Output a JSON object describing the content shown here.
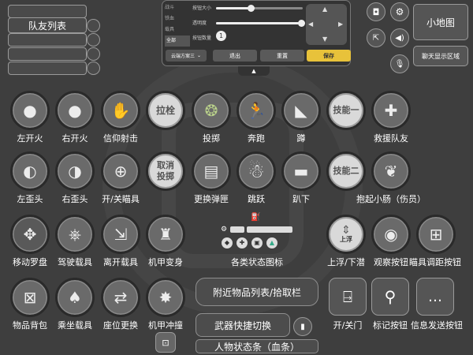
{
  "team": {
    "title": "队友列表"
  },
  "settings": {
    "tabs": [
      "战斗",
      "铁血",
      "载具",
      "全部"
    ],
    "sliders": [
      {
        "label": "按钮大小",
        "value": 0.4
      },
      {
        "label": "透明度",
        "value": 0.98
      }
    ],
    "count_label": "按钮数量",
    "count_value": "1",
    "scheme": "云端方案三",
    "exit_label": "退出",
    "reset_label": "重置",
    "save_label": "保存"
  },
  "right_top": {
    "minimap_label": "小地图",
    "chat_area_label": "聊天显示区域"
  },
  "buttons": {
    "fire_left": "左开火",
    "fire_right": "右开火",
    "faith_shoot": "信仰射击",
    "pull_pin_text": "拉栓",
    "pull_pin_label": "",
    "throw": "投掷",
    "run": "奔跑",
    "crouch": "蹲",
    "skill1_text": "技能一",
    "rescue": "救援队友",
    "lean_left": "左歪头",
    "lean_right": "右歪头",
    "scope": "开/关瞄具",
    "cancel_throw_text": "取消\n投掷",
    "reload": "更换弹匣",
    "jump": "跳跃",
    "prone": "趴下",
    "skill2_text": "技能二",
    "carry": "抱起小肠（伤员）",
    "compass": "移动罗盘",
    "drive": "驾驶载具",
    "leave_vehicle": "离开载具",
    "mech_transform": "机甲变身",
    "status_icons": "各类状态图标",
    "float_dive_small": "上浮",
    "float_dive": "上浮/下潜",
    "observe": "观察按钮",
    "scope_adjust": "瞄具调距按钮",
    "backpack": "物品背包",
    "ride": "乘坐载具",
    "seat_change": "座位更换",
    "mech_charge": "机甲冲撞",
    "nearby_items": "附近物品列表/拾取栏",
    "weapon_switch": "武器快捷切换",
    "health_bar": "人物状态条（血条）",
    "door": "开/关门",
    "mark": "标记按钮",
    "send_msg": "信息发送按钮"
  }
}
